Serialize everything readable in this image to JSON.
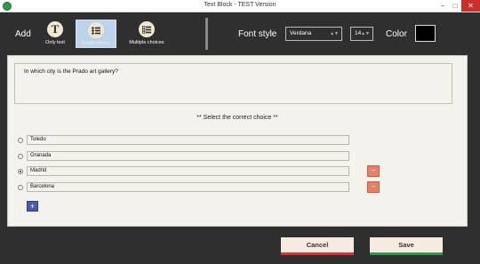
{
  "window": {
    "title": "Text Block - TEST Version",
    "min_glyph": "–",
    "max_glyph": "□",
    "close_glyph": "✕"
  },
  "toolbar": {
    "add_label": "Add",
    "tools": {
      "only_text": {
        "label": "Only text",
        "icon_glyph": "T",
        "icon": "text-icon"
      },
      "single_choice": {
        "label": "Single choice",
        "icon": "list-icon",
        "selected": true
      },
      "multiple_choices": {
        "label": "Multiple choices",
        "icon": "checklist-icon"
      }
    },
    "font_style_label": "Font style",
    "font_value": "Verdana",
    "size_value": "14",
    "color_label": "Color",
    "color_value": "#000000"
  },
  "question": {
    "text": "In which city is the Prado art gallery?"
  },
  "instruction": "** Select the correct choice **",
  "choices": [
    {
      "text": "Toledo",
      "selected": false,
      "removable": false
    },
    {
      "text": "Granada",
      "selected": false,
      "removable": false
    },
    {
      "text": "Madrid",
      "selected": true,
      "removable": true
    },
    {
      "text": "Barcelona",
      "selected": false,
      "removable": true
    }
  ],
  "add_choice_glyph": "+",
  "remove_glyph": "−",
  "dropdown_glyph": "▲▼",
  "buttons": {
    "cancel": "Cancel",
    "save": "Save"
  },
  "colors": {
    "cancel_accent": "#d8312f",
    "save_accent": "#2e9a46",
    "remove_button": "#e87f66",
    "add_button": "#4a5aa8"
  }
}
